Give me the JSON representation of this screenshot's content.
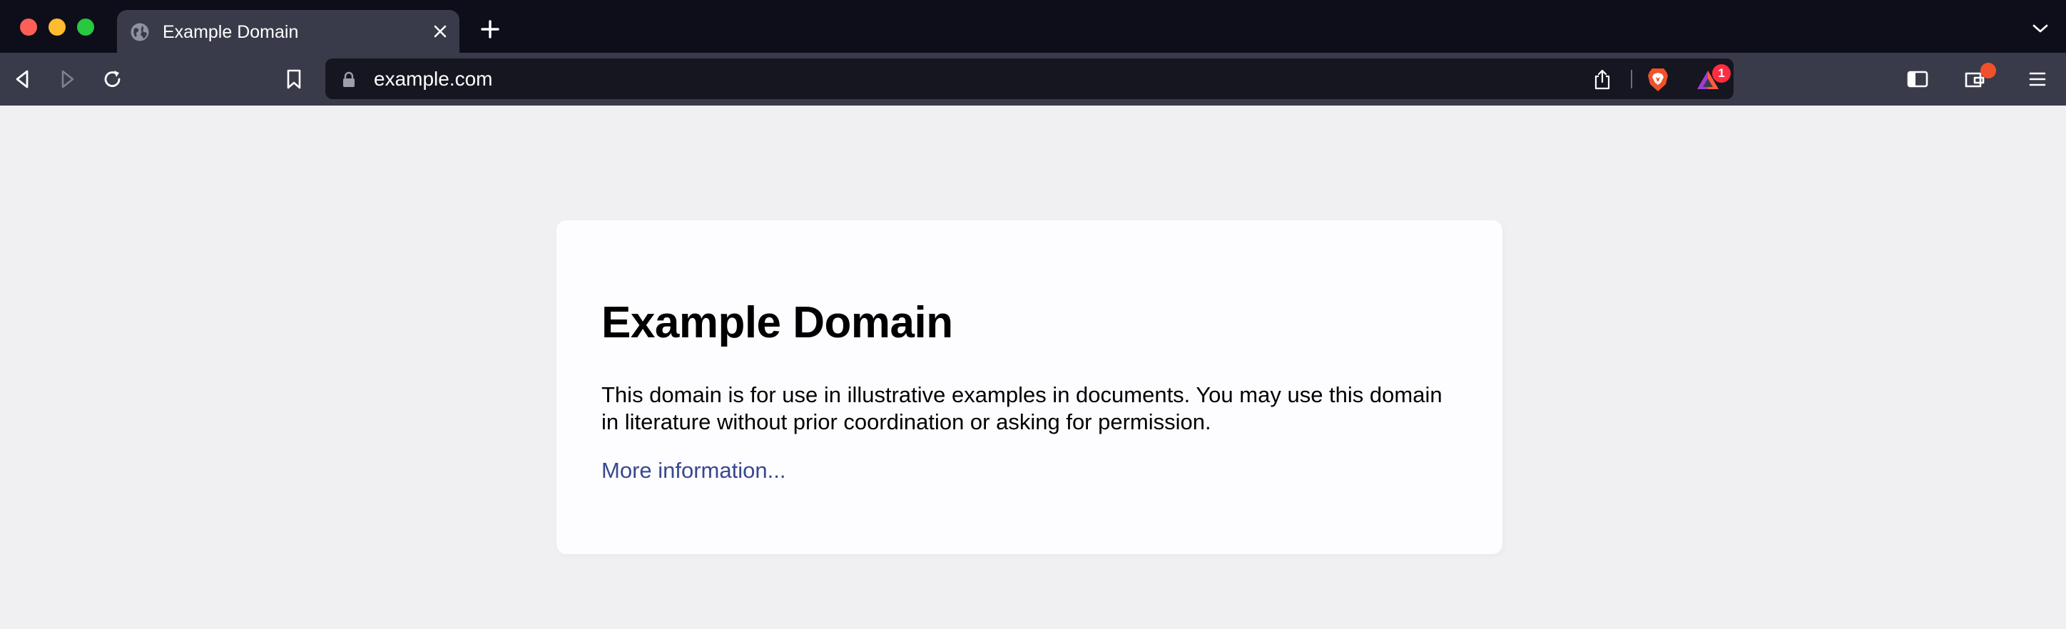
{
  "tab": {
    "title": "Example Domain",
    "favicon": "globe-icon",
    "close_icon": "close-icon"
  },
  "tabstrip": {
    "new_tab_icon": "plus-icon",
    "tabs_menu_icon": "chevron-down-icon"
  },
  "toolbar": {
    "back_icon": "back-arrow-icon",
    "forward_icon": "forward-arrow-icon",
    "reload_icon": "reload-icon",
    "bookmark_icon": "bookmark-icon",
    "sidebar_icon": "sidebar-icon",
    "wallet_icon": "wallet-icon",
    "menu_icon": "hamburger-menu-icon"
  },
  "address_bar": {
    "url": "example.com",
    "lock_icon": "lock-icon",
    "share_icon": "share-icon",
    "shield_icon": "brave-shield-icon",
    "rewards_icon": "brave-rewards-icon",
    "rewards_badge": "1"
  },
  "page": {
    "heading": "Example Domain",
    "paragraph": "This domain is for use in illustrative examples in documents. You may use this domain in literature without prior coordination or asking for permission.",
    "link_text": "More information..."
  },
  "colors": {
    "tabstrip_bg": "#0d0e1a",
    "toolbar_bg": "#393b4a",
    "page_bg": "#f0f0f2",
    "link": "#38488f",
    "brave_orange": "#f2502b"
  }
}
